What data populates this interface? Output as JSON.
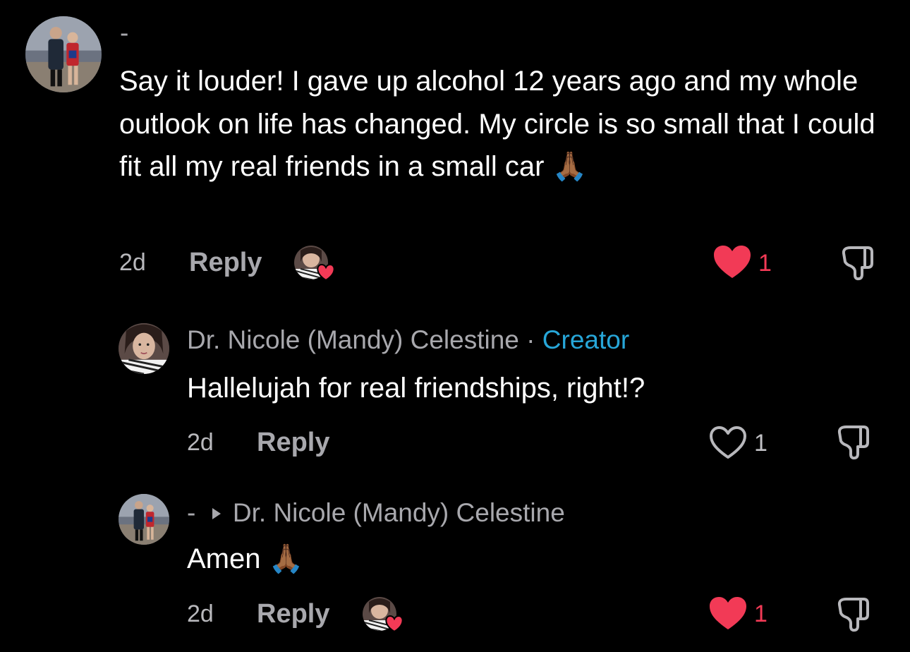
{
  "comments": [
    {
      "username": "-",
      "text": "Say it louder! I gave up alcohol 12 years ago and my whole outlook on life has changed. My circle is so small that I could fit all my real friends in a small car 🙏🏾",
      "time": "2d",
      "reply_label": "Reply",
      "likes": "1",
      "liked": true,
      "creator_liked": true
    },
    {
      "username": "Dr. Nicole (Mandy) Celestine",
      "separator": "·",
      "badge": "Creator",
      "text": "Hallelujah for real friendships, right!?",
      "time": "2d",
      "reply_label": "Reply",
      "likes": "1",
      "liked": false
    },
    {
      "username": "-",
      "reply_to": "Dr. Nicole (Mandy) Celestine",
      "text": "Amen 🙏🏾",
      "time": "2d",
      "reply_label": "Reply",
      "likes": "1",
      "liked": true,
      "creator_liked": true
    }
  ],
  "colors": {
    "background": "#000000",
    "like_red": "#f23a56",
    "creator_blue": "#27a6d8",
    "muted_text": "#a8a8ad"
  },
  "icons": [
    "heart-filled-icon",
    "heart-outline-icon",
    "dislike-icon",
    "caret-right-icon",
    "creator-liked-heart-icon"
  ]
}
